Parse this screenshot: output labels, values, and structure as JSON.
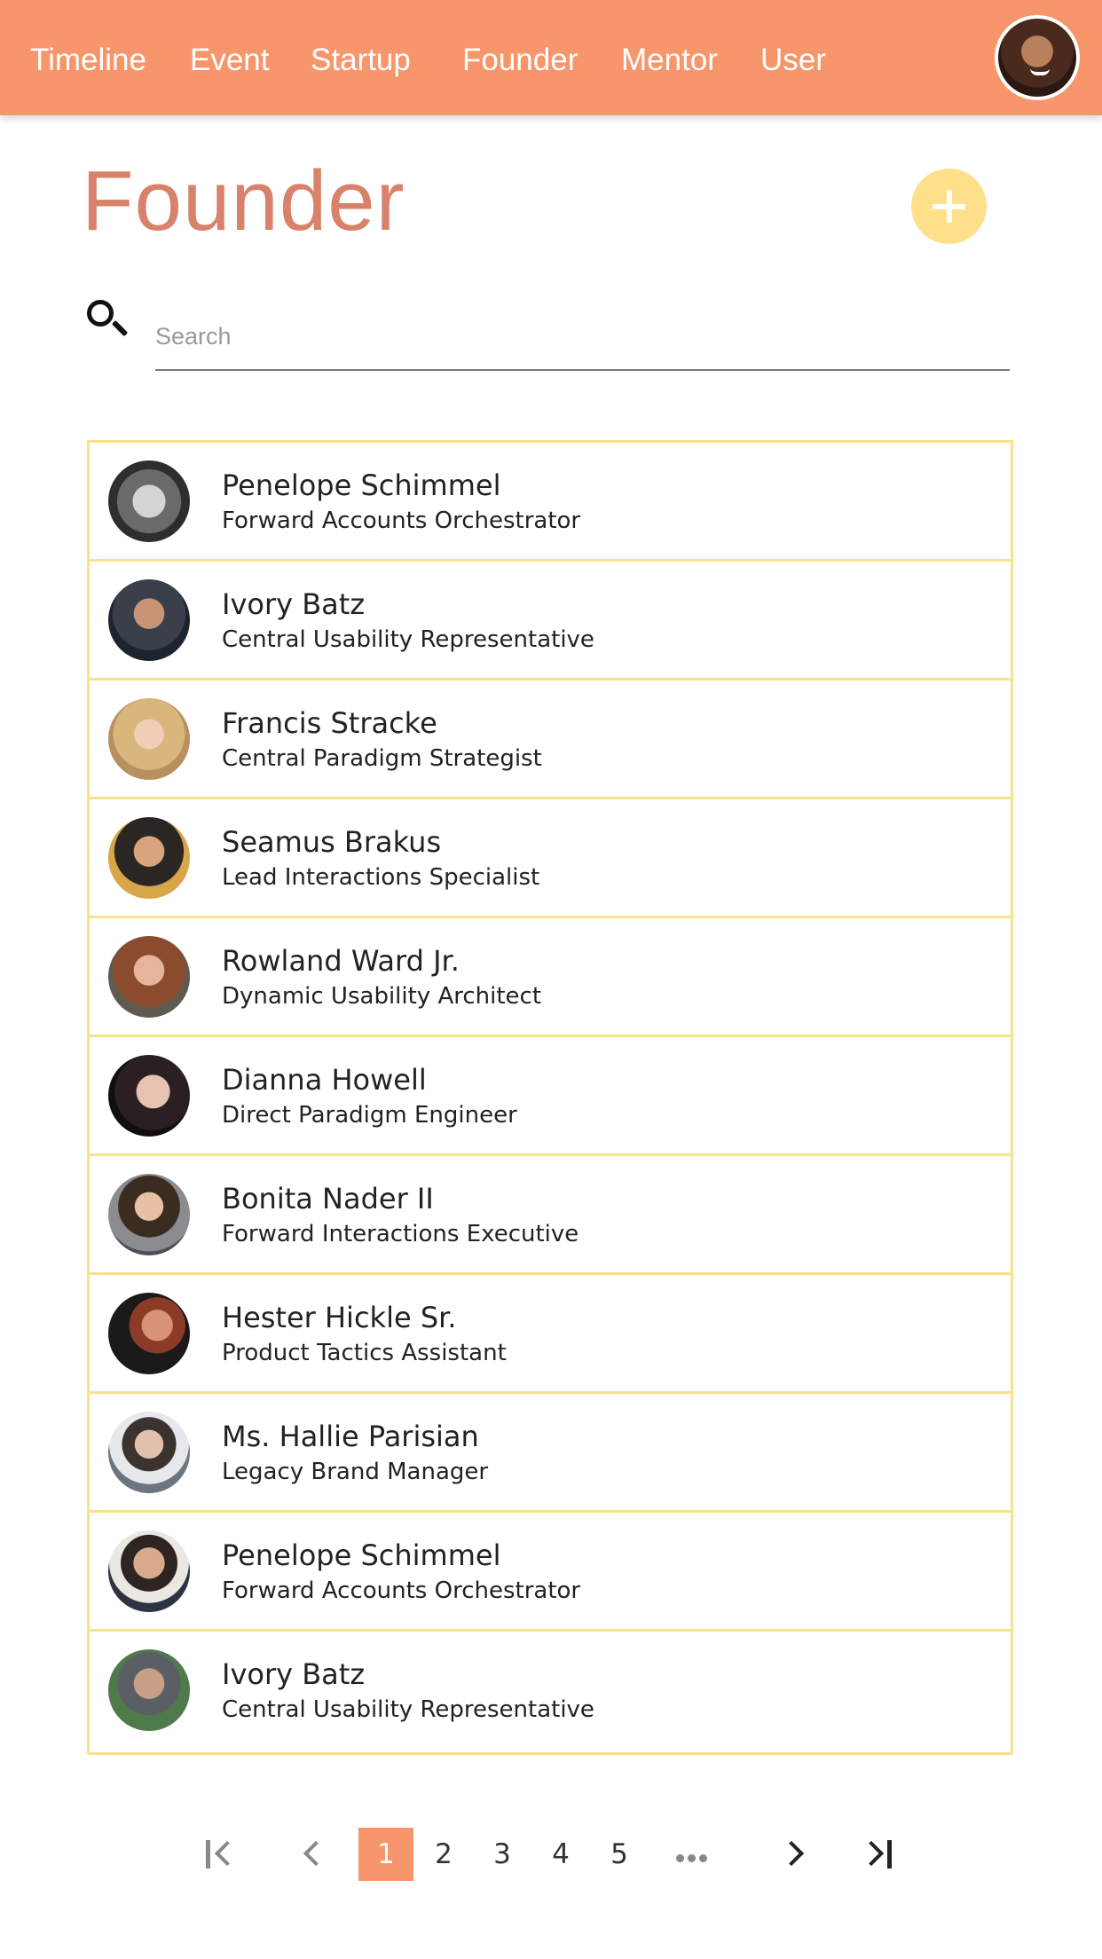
{
  "nav": {
    "items": [
      "Timeline",
      "Event",
      "Startup",
      "Founder",
      "Mentor",
      "User"
    ]
  },
  "header": {
    "title": "Founder"
  },
  "search": {
    "placeholder": "Search",
    "value": ""
  },
  "founders": [
    {
      "name": "Penelope Schimmel",
      "role": "Forward Accounts Orchestrator"
    },
    {
      "name": "Ivory Batz",
      "role": "Central Usability Representative"
    },
    {
      "name": "Francis Stracke",
      "role": "Central Paradigm Strategist"
    },
    {
      "name": "Seamus Brakus",
      "role": "Lead Interactions Specialist"
    },
    {
      "name": "Rowland Ward Jr.",
      "role": "Dynamic Usability Architect"
    },
    {
      "name": "Dianna Howell",
      "role": "Direct Paradigm Engineer"
    },
    {
      "name": "Bonita Nader II",
      "role": "Forward Interactions Executive"
    },
    {
      "name": "Hester Hickle Sr.",
      "role": "Product Tactics Assistant"
    },
    {
      "name": "Ms. Hallie Parisian",
      "role": "Legacy Brand Manager"
    },
    {
      "name": "Penelope Schimmel",
      "role": "Forward Accounts Orchestrator"
    },
    {
      "name": "Ivory Batz",
      "role": "Central Usability Representative"
    }
  ],
  "pagination": {
    "pages": [
      "1",
      "2",
      "3",
      "4",
      "5"
    ],
    "current": "1"
  },
  "colors": {
    "brand": "#f7956b",
    "title": "#d9826b",
    "accent": "#fedf8a",
    "row_border": "#fbe18c"
  }
}
